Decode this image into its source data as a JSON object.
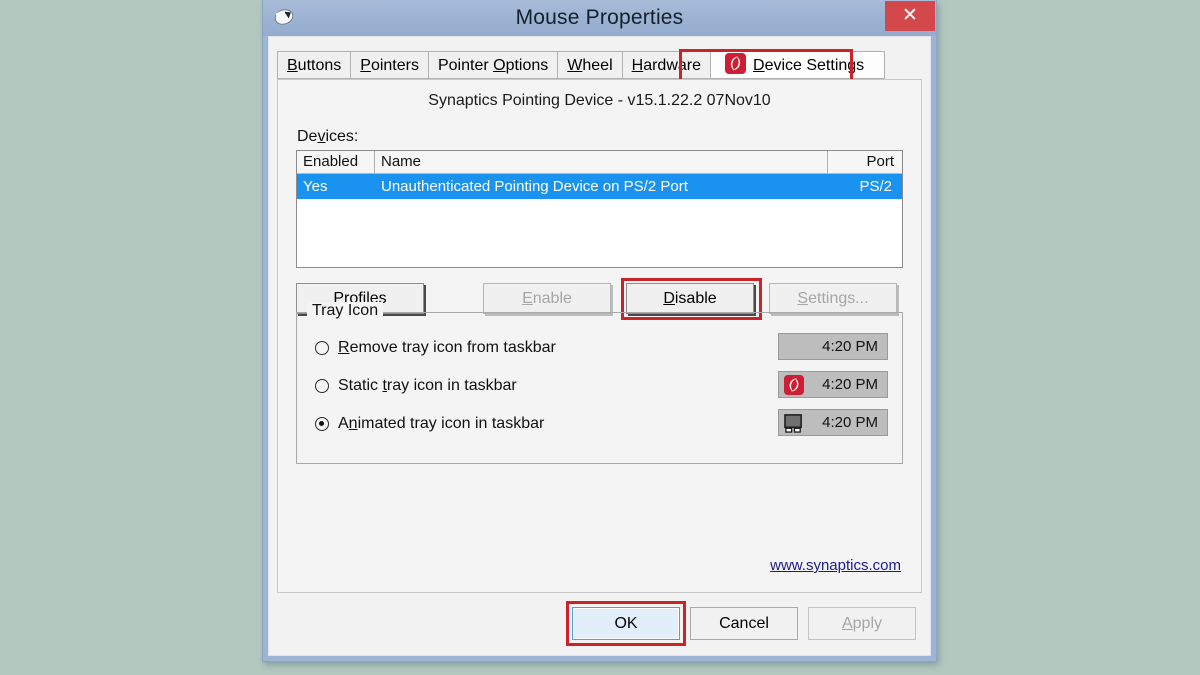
{
  "desktop": {
    "background_color": "#b3c9bf"
  },
  "window": {
    "title": "Mouse Properties",
    "icon": "mouse-icon",
    "close_label": "✕",
    "accent_close_color": "#d2484b",
    "titlebar_color": "#9bb2d2"
  },
  "tabs": [
    {
      "label": "Buttons",
      "accel": "B",
      "active": false
    },
    {
      "label": "Pointers",
      "accel": "P",
      "active": false
    },
    {
      "label": "Pointer Options",
      "accel": "O",
      "active": false
    },
    {
      "label": "Wheel",
      "accel": "W",
      "active": false
    },
    {
      "label": "Hardware",
      "accel": "H",
      "active": false
    },
    {
      "label": "Device Settings",
      "accel": "D",
      "active": true,
      "icon": "synaptics-logo-icon"
    }
  ],
  "panel": {
    "device_title": "Synaptics Pointing Device - v15.1.22.2 07Nov10",
    "devices_label": "Devices:",
    "devices_label_accel": "v",
    "list": {
      "columns": [
        "Enabled",
        "Name",
        "Port"
      ],
      "rows": [
        {
          "enabled": "Yes",
          "name": "Unauthenticated Pointing Device on PS/2 Port",
          "port": "PS/2",
          "selected": true
        }
      ]
    },
    "buttons": [
      {
        "label": "Profiles",
        "accel": "P",
        "disabled": false,
        "highlighted": false
      },
      {
        "label": "Enable",
        "accel": "E",
        "disabled": true,
        "highlighted": false
      },
      {
        "label": "Disable",
        "accel": "D",
        "disabled": false,
        "highlighted": true
      },
      {
        "label": "Settings...",
        "accel": "S",
        "disabled": true,
        "highlighted": false
      }
    ],
    "tray_group": {
      "title": "Tray Icon",
      "options": [
        {
          "label": "Remove tray icon from taskbar",
          "accel": "R",
          "selected": false,
          "preview_time": "4:20 PM",
          "preview_icon": "none"
        },
        {
          "label": "Static tray icon in taskbar",
          "accel": "t",
          "selected": false,
          "preview_time": "4:20 PM",
          "preview_icon": "synaptics-logo-icon"
        },
        {
          "label": "Animated tray icon in taskbar",
          "accel": "n",
          "selected": true,
          "preview_time": "4:20 PM",
          "preview_icon": "touchpad-icon"
        }
      ]
    },
    "web_link": "www.synaptics.com"
  },
  "footer": {
    "ok": {
      "label": "OK",
      "focused": true,
      "highlighted": true
    },
    "cancel": {
      "label": "Cancel"
    },
    "apply": {
      "label": "Apply",
      "accel": "A",
      "disabled": true
    }
  },
  "annotations": {
    "color": "#cc2229",
    "boxes": [
      "device-settings-tab",
      "disable-button",
      "ok-button"
    ]
  }
}
